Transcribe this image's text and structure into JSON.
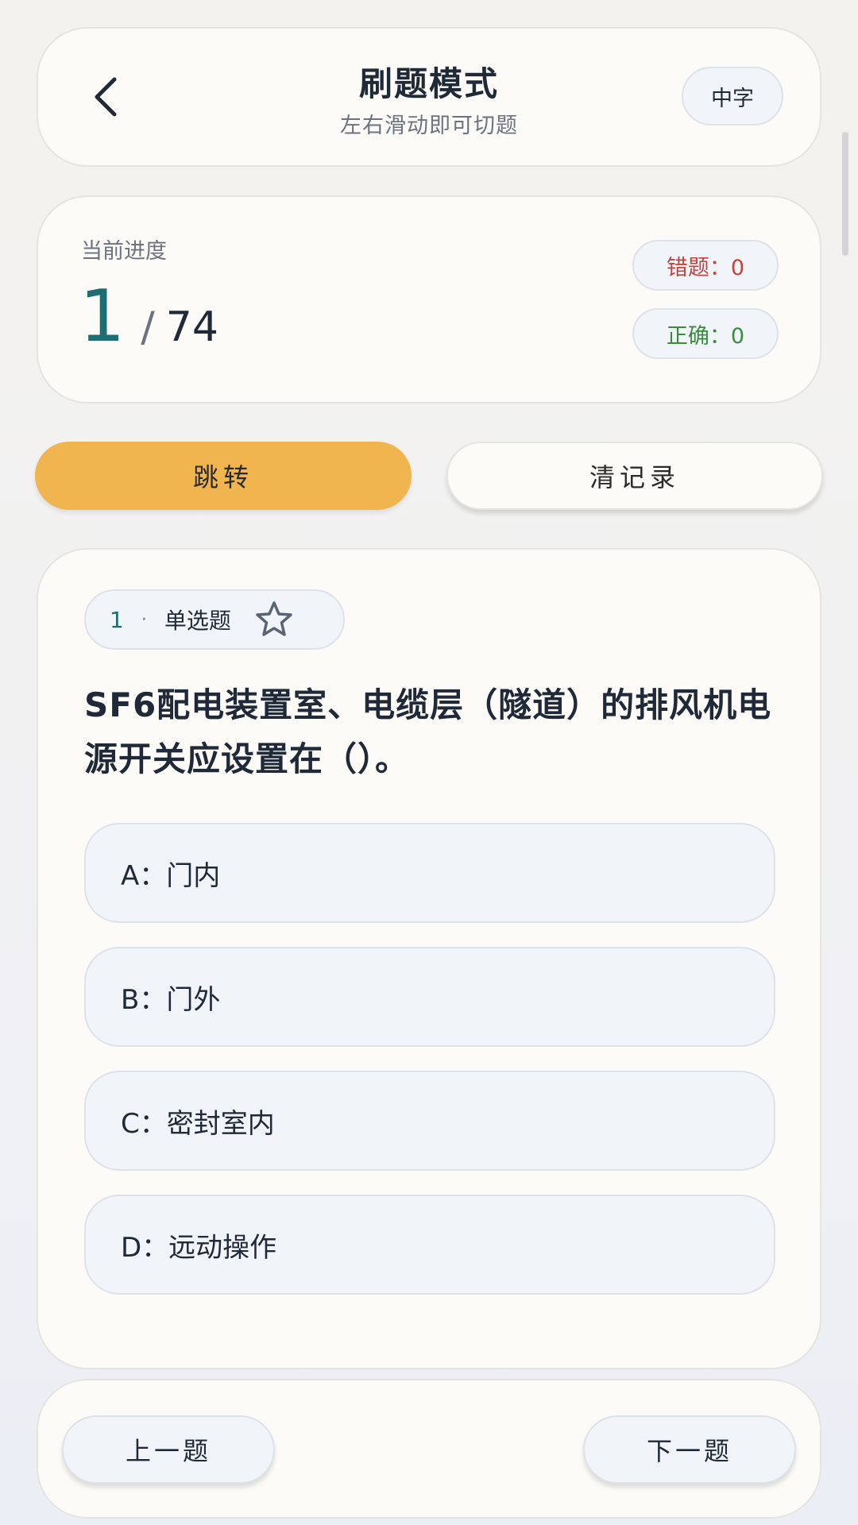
{
  "header": {
    "title": "刷题模式",
    "subtitle": "左右滑动即可切题",
    "font_size_label": "中字",
    "back_icon": "chevron-left-icon"
  },
  "progress": {
    "label": "当前进度",
    "current": "1",
    "separator": "/",
    "total": "74",
    "wrong_label": "错题：0",
    "correct_label": "正确：0"
  },
  "actions": {
    "jump_label": "跳转",
    "clear_label": "清记录"
  },
  "question": {
    "number": "1",
    "dot": "·",
    "type": "单选题",
    "favorite_icon": "star-outline-icon",
    "text": "SF6配电装置室、电缆层（隧道）的排风机电源开关应设置在（）。",
    "options": [
      {
        "label": "A：门内"
      },
      {
        "label": "B：门外"
      },
      {
        "label": "C：密封室内"
      },
      {
        "label": "D：远动操作"
      }
    ]
  },
  "navigation": {
    "prev_label": "上一题",
    "next_label": "下一题"
  },
  "colors": {
    "accent": "#1d6e73",
    "jump_button": "#f0b54f",
    "wrong": "#c0453e",
    "correct": "#3c8a3e"
  }
}
